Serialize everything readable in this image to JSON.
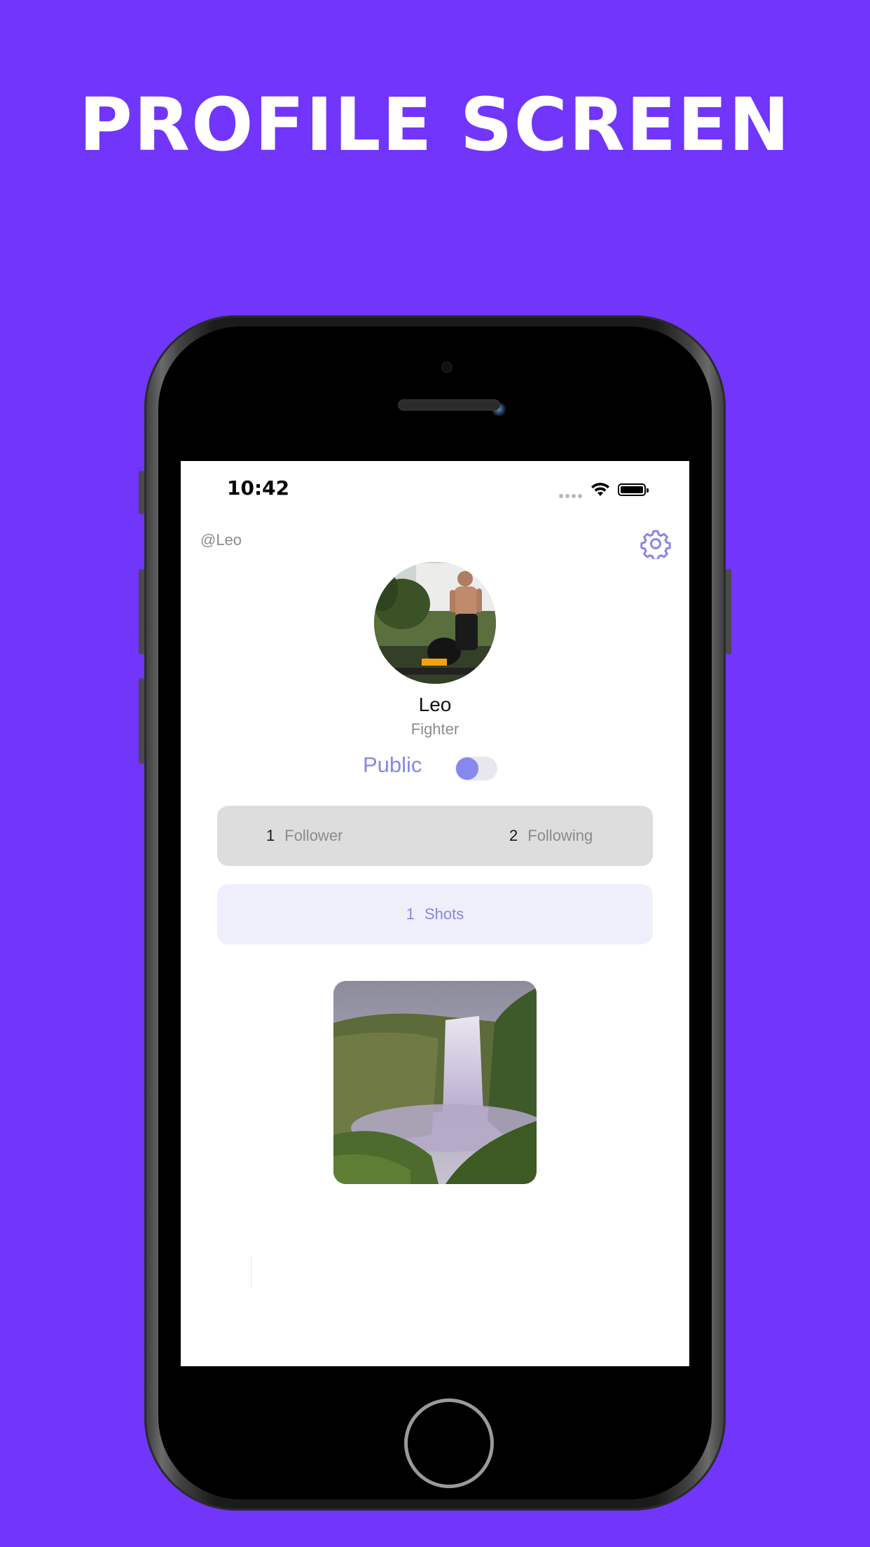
{
  "headline": "PROFILE SCREEN",
  "status_bar": {
    "time": "10:42"
  },
  "profile": {
    "handle": "@Leo",
    "name": "Leo",
    "role": "Fighter",
    "visibility_label": "Public",
    "visibility_on": true
  },
  "stats": {
    "followers": {
      "count": "1",
      "label": "Follower"
    },
    "following": {
      "count": "2",
      "label": "Following"
    },
    "shots": {
      "count": "1",
      "label": "Shots"
    }
  },
  "icons": [
    "settings-gear-icon",
    "wifi-icon",
    "battery-icon",
    "signal-icon"
  ],
  "colors": {
    "background": "#7135fb",
    "accent": "#8686e8",
    "card_gray": "#dddddd",
    "card_lavender": "#efeffb"
  }
}
